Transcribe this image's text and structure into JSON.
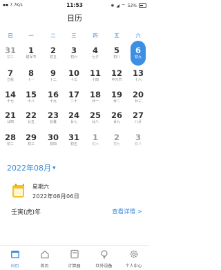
{
  "status_bar": {
    "left_text": "7.7K/s",
    "time": "11:53",
    "battery": "52%"
  },
  "title": "日历",
  "weekdays": [
    "日",
    "一",
    "二",
    "三",
    "四",
    "五",
    "六"
  ],
  "calendar_rows": [
    [
      {
        "d": "31",
        "l": "初三",
        "dim": true
      },
      {
        "d": "1",
        "l": "建军节"
      },
      {
        "d": "2",
        "l": "初五"
      },
      {
        "d": "3",
        "l": "初六"
      },
      {
        "d": "4",
        "l": "七夕"
      },
      {
        "d": "5",
        "l": "初八"
      },
      {
        "d": "6",
        "l": "初九",
        "sel": true
      }
    ],
    [
      {
        "d": "7",
        "l": "立秋"
      },
      {
        "d": "8",
        "l": "十一"
      },
      {
        "d": "9",
        "l": "十二"
      },
      {
        "d": "10",
        "l": "十三"
      },
      {
        "d": "11",
        "l": "十四"
      },
      {
        "d": "12",
        "l": "中元节"
      },
      {
        "d": "13",
        "l": "十六"
      }
    ],
    [
      {
        "d": "14",
        "l": "十七"
      },
      {
        "d": "15",
        "l": "十八"
      },
      {
        "d": "16",
        "l": "十九"
      },
      {
        "d": "17",
        "l": "二十"
      },
      {
        "d": "18",
        "l": "廿一"
      },
      {
        "d": "19",
        "l": "廿二"
      },
      {
        "d": "20",
        "l": "廿三"
      }
    ],
    [
      {
        "d": "21",
        "l": "廿四"
      },
      {
        "d": "22",
        "l": "廿五"
      },
      {
        "d": "23",
        "l": "处暑"
      },
      {
        "d": "24",
        "l": "廿七"
      },
      {
        "d": "25",
        "l": "廿八"
      },
      {
        "d": "26",
        "l": "廿九"
      },
      {
        "d": "27",
        "l": "八月"
      }
    ],
    [
      {
        "d": "28",
        "l": "初二"
      },
      {
        "d": "29",
        "l": "初三"
      },
      {
        "d": "30",
        "l": "初四"
      },
      {
        "d": "31",
        "l": "初五"
      },
      {
        "d": "1",
        "l": "初六",
        "dim": true
      },
      {
        "d": "2",
        "l": "初七",
        "dim": true
      },
      {
        "d": "3",
        "l": "初八",
        "dim": true
      }
    ]
  ],
  "month_label": "2022年08月",
  "info": {
    "weekday": "星期六",
    "date": "2022年08月06日",
    "ganzhi": "壬寅(虎)年",
    "detail_link": "查看详情 >"
  },
  "tabs": [
    {
      "label": "日历",
      "icon": "calendar-icon",
      "active": true
    },
    {
      "label": "首页",
      "icon": "home-icon"
    },
    {
      "label": "计算器",
      "icon": "calculator-icon"
    },
    {
      "label": "红外设备",
      "icon": "lightbulb-icon"
    },
    {
      "label": "个人中心",
      "icon": "gear-icon"
    }
  ],
  "colors": {
    "accent": "#3d8fe4",
    "weekday_header": "#3b8bd8",
    "calendar_icon": "#f5c21c"
  }
}
